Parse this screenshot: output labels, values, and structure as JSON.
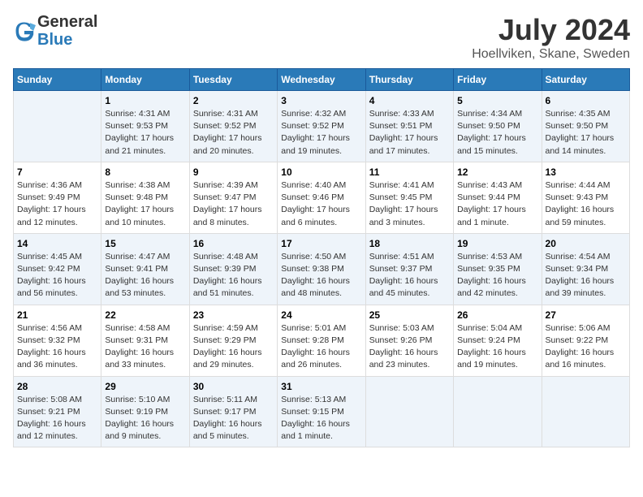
{
  "header": {
    "logo_line1": "General",
    "logo_line2": "Blue",
    "month": "July 2024",
    "location": "Hoellviken, Skane, Sweden"
  },
  "days_of_week": [
    "Sunday",
    "Monday",
    "Tuesday",
    "Wednesday",
    "Thursday",
    "Friday",
    "Saturday"
  ],
  "weeks": [
    [
      {
        "day": "",
        "info": ""
      },
      {
        "day": "1",
        "info": "Sunrise: 4:31 AM\nSunset: 9:53 PM\nDaylight: 17 hours\nand 21 minutes."
      },
      {
        "day": "2",
        "info": "Sunrise: 4:31 AM\nSunset: 9:52 PM\nDaylight: 17 hours\nand 20 minutes."
      },
      {
        "day": "3",
        "info": "Sunrise: 4:32 AM\nSunset: 9:52 PM\nDaylight: 17 hours\nand 19 minutes."
      },
      {
        "day": "4",
        "info": "Sunrise: 4:33 AM\nSunset: 9:51 PM\nDaylight: 17 hours\nand 17 minutes."
      },
      {
        "day": "5",
        "info": "Sunrise: 4:34 AM\nSunset: 9:50 PM\nDaylight: 17 hours\nand 15 minutes."
      },
      {
        "day": "6",
        "info": "Sunrise: 4:35 AM\nSunset: 9:50 PM\nDaylight: 17 hours\nand 14 minutes."
      }
    ],
    [
      {
        "day": "7",
        "info": "Sunrise: 4:36 AM\nSunset: 9:49 PM\nDaylight: 17 hours\nand 12 minutes."
      },
      {
        "day": "8",
        "info": "Sunrise: 4:38 AM\nSunset: 9:48 PM\nDaylight: 17 hours\nand 10 minutes."
      },
      {
        "day": "9",
        "info": "Sunrise: 4:39 AM\nSunset: 9:47 PM\nDaylight: 17 hours\nand 8 minutes."
      },
      {
        "day": "10",
        "info": "Sunrise: 4:40 AM\nSunset: 9:46 PM\nDaylight: 17 hours\nand 6 minutes."
      },
      {
        "day": "11",
        "info": "Sunrise: 4:41 AM\nSunset: 9:45 PM\nDaylight: 17 hours\nand 3 minutes."
      },
      {
        "day": "12",
        "info": "Sunrise: 4:43 AM\nSunset: 9:44 PM\nDaylight: 17 hours\nand 1 minute."
      },
      {
        "day": "13",
        "info": "Sunrise: 4:44 AM\nSunset: 9:43 PM\nDaylight: 16 hours\nand 59 minutes."
      }
    ],
    [
      {
        "day": "14",
        "info": "Sunrise: 4:45 AM\nSunset: 9:42 PM\nDaylight: 16 hours\nand 56 minutes."
      },
      {
        "day": "15",
        "info": "Sunrise: 4:47 AM\nSunset: 9:41 PM\nDaylight: 16 hours\nand 53 minutes."
      },
      {
        "day": "16",
        "info": "Sunrise: 4:48 AM\nSunset: 9:39 PM\nDaylight: 16 hours\nand 51 minutes."
      },
      {
        "day": "17",
        "info": "Sunrise: 4:50 AM\nSunset: 9:38 PM\nDaylight: 16 hours\nand 48 minutes."
      },
      {
        "day": "18",
        "info": "Sunrise: 4:51 AM\nSunset: 9:37 PM\nDaylight: 16 hours\nand 45 minutes."
      },
      {
        "day": "19",
        "info": "Sunrise: 4:53 AM\nSunset: 9:35 PM\nDaylight: 16 hours\nand 42 minutes."
      },
      {
        "day": "20",
        "info": "Sunrise: 4:54 AM\nSunset: 9:34 PM\nDaylight: 16 hours\nand 39 minutes."
      }
    ],
    [
      {
        "day": "21",
        "info": "Sunrise: 4:56 AM\nSunset: 9:32 PM\nDaylight: 16 hours\nand 36 minutes."
      },
      {
        "day": "22",
        "info": "Sunrise: 4:58 AM\nSunset: 9:31 PM\nDaylight: 16 hours\nand 33 minutes."
      },
      {
        "day": "23",
        "info": "Sunrise: 4:59 AM\nSunset: 9:29 PM\nDaylight: 16 hours\nand 29 minutes."
      },
      {
        "day": "24",
        "info": "Sunrise: 5:01 AM\nSunset: 9:28 PM\nDaylight: 16 hours\nand 26 minutes."
      },
      {
        "day": "25",
        "info": "Sunrise: 5:03 AM\nSunset: 9:26 PM\nDaylight: 16 hours\nand 23 minutes."
      },
      {
        "day": "26",
        "info": "Sunrise: 5:04 AM\nSunset: 9:24 PM\nDaylight: 16 hours\nand 19 minutes."
      },
      {
        "day": "27",
        "info": "Sunrise: 5:06 AM\nSunset: 9:22 PM\nDaylight: 16 hours\nand 16 minutes."
      }
    ],
    [
      {
        "day": "28",
        "info": "Sunrise: 5:08 AM\nSunset: 9:21 PM\nDaylight: 16 hours\nand 12 minutes."
      },
      {
        "day": "29",
        "info": "Sunrise: 5:10 AM\nSunset: 9:19 PM\nDaylight: 16 hours\nand 9 minutes."
      },
      {
        "day": "30",
        "info": "Sunrise: 5:11 AM\nSunset: 9:17 PM\nDaylight: 16 hours\nand 5 minutes."
      },
      {
        "day": "31",
        "info": "Sunrise: 5:13 AM\nSunset: 9:15 PM\nDaylight: 16 hours\nand 1 minute."
      },
      {
        "day": "",
        "info": ""
      },
      {
        "day": "",
        "info": ""
      },
      {
        "day": "",
        "info": ""
      }
    ]
  ]
}
